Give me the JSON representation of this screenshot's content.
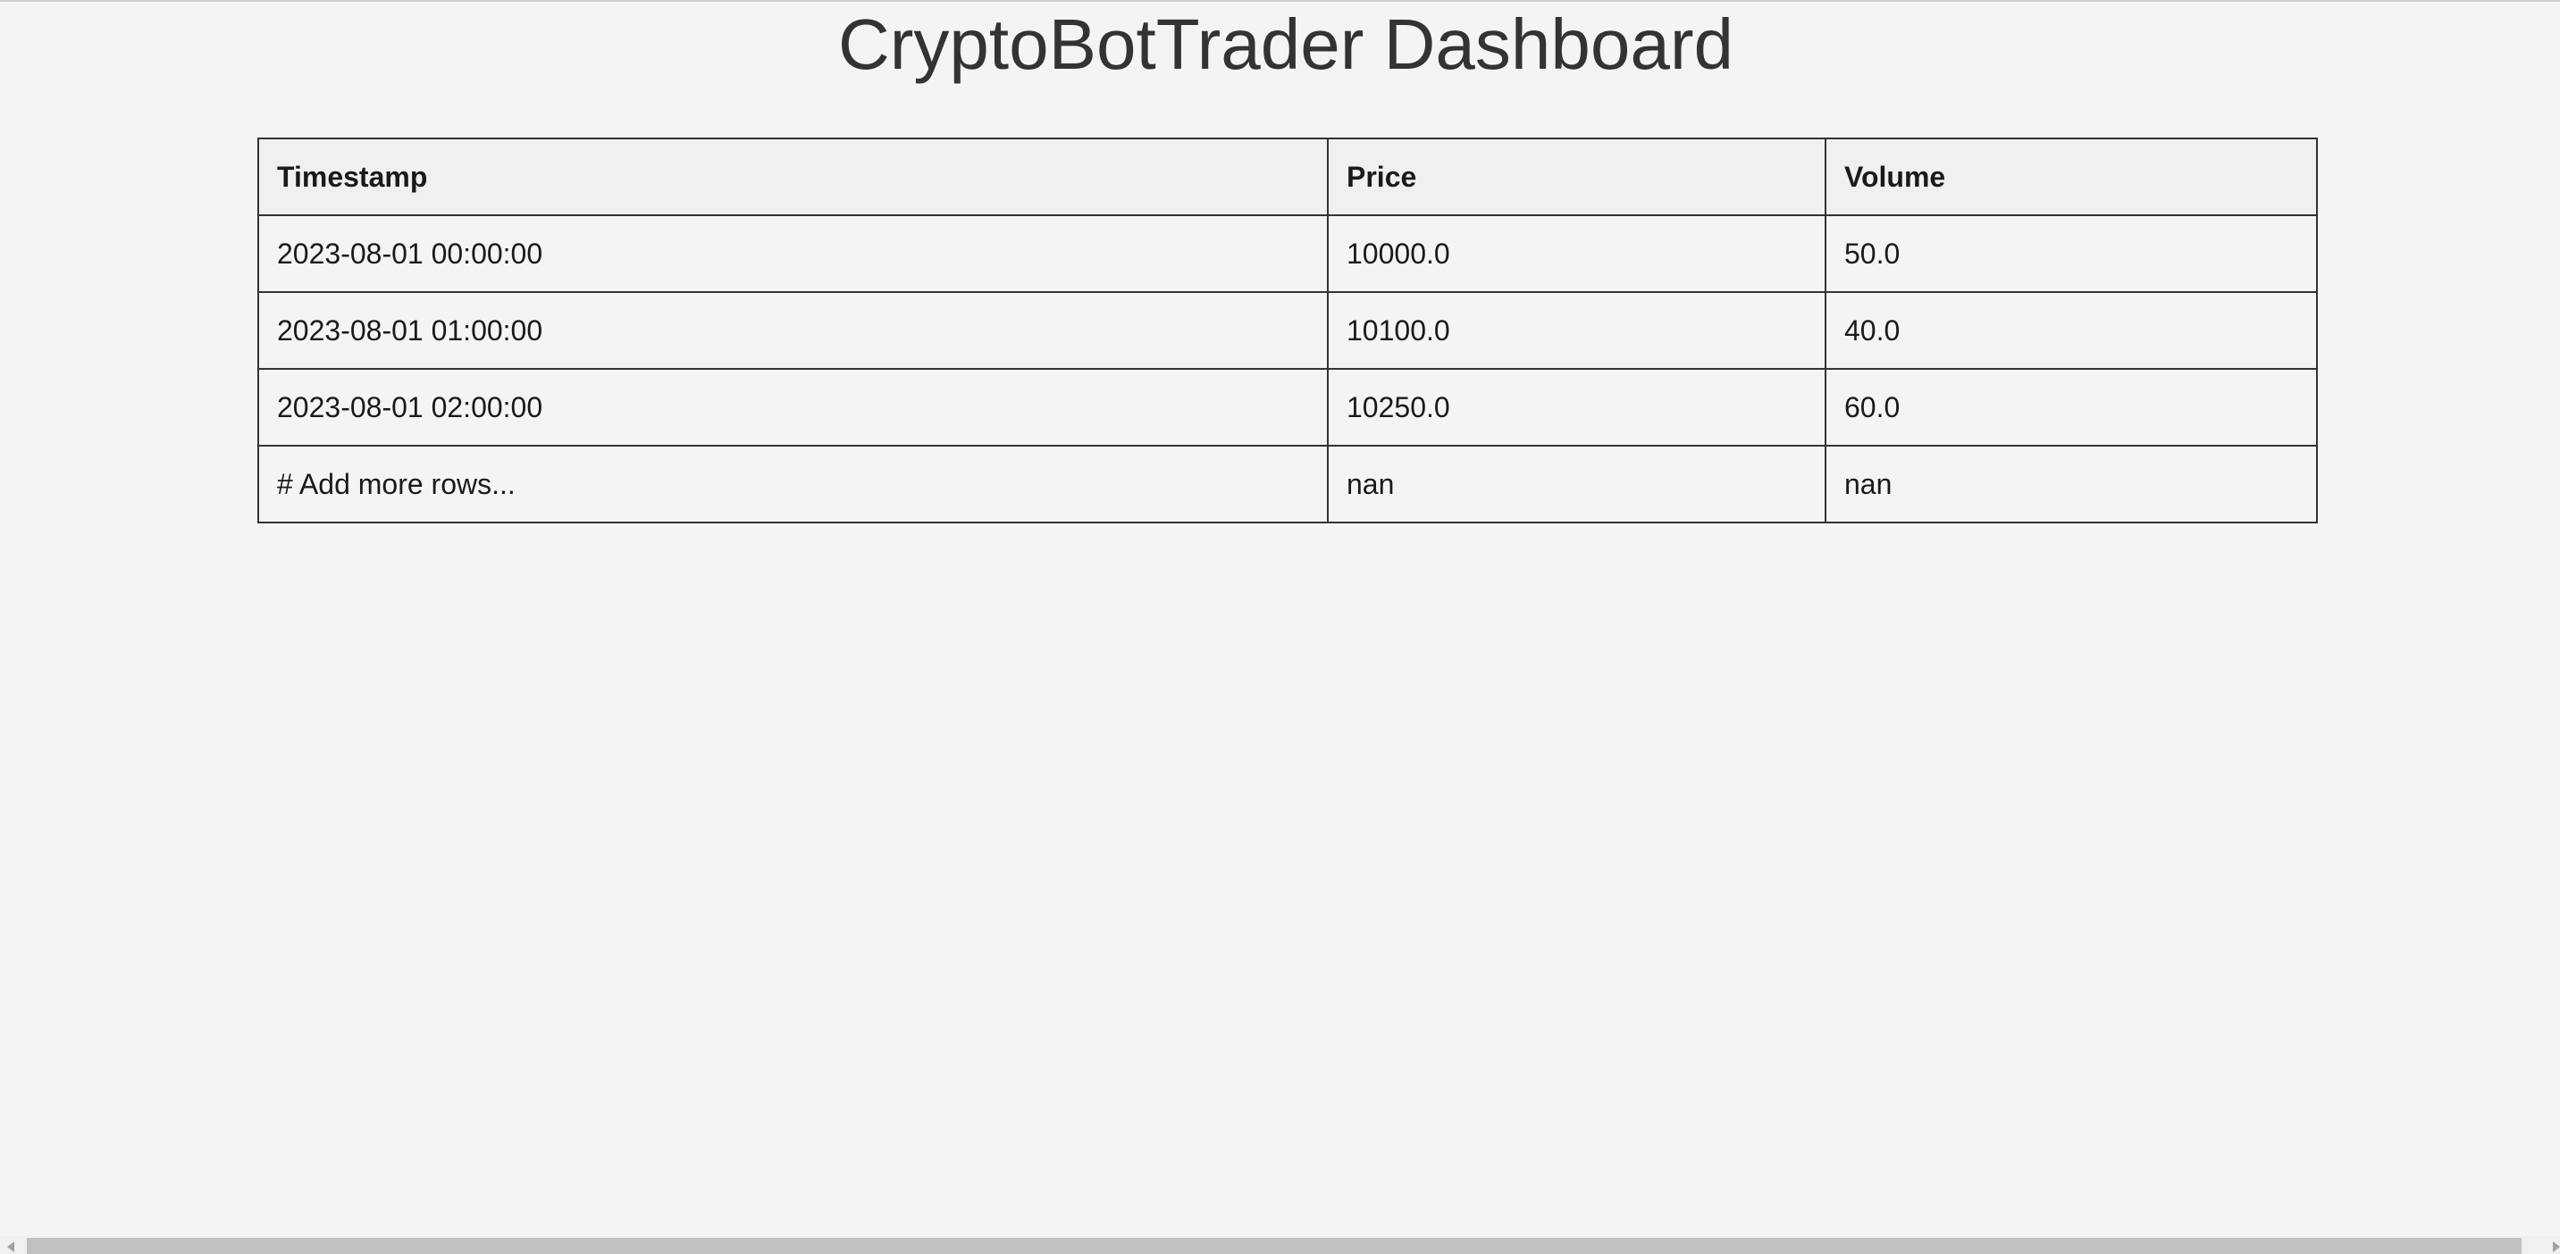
{
  "page": {
    "title": "CryptoBotTrader Dashboard"
  },
  "table": {
    "columns": [
      "Timestamp",
      "Price",
      "Volume"
    ],
    "rows": [
      [
        "2023-08-01 00:00:00",
        "10000.0",
        "50.0"
      ],
      [
        "2023-08-01 01:00:00",
        "10100.0",
        "40.0"
      ],
      [
        "2023-08-01 02:00:00",
        "10250.0",
        "60.0"
      ],
      [
        "# Add more rows...",
        "nan",
        "nan"
      ]
    ]
  },
  "scrollbar": {
    "left_arrow_icon": "chevron-left-icon",
    "right_arrow_icon": "chevron-right-icon"
  }
}
